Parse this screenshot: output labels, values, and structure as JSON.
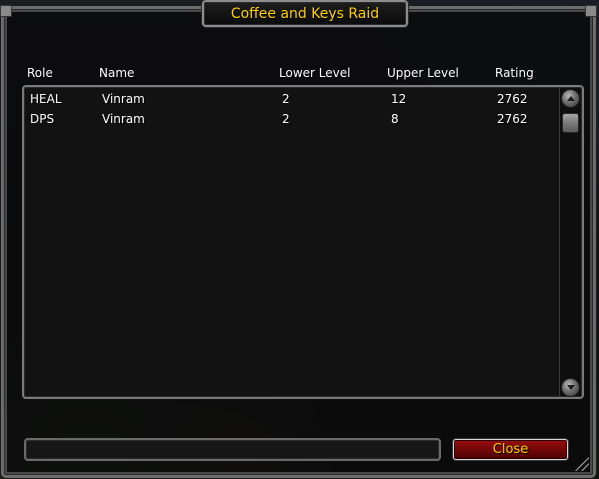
{
  "window": {
    "title": "Coffee and Keys Raid"
  },
  "columns": [
    "Role",
    "Name",
    "Lower Level",
    "Upper Level",
    "Rating"
  ],
  "rows": [
    {
      "role": "HEAL",
      "name": "Vinram",
      "lower": "2",
      "upper": "12",
      "rating": "2762"
    },
    {
      "role": "DPS",
      "name": "Vinram",
      "lower": "2",
      "upper": "8",
      "rating": "2762"
    }
  ],
  "footer": {
    "status_text": "",
    "close_label": "Close"
  },
  "icons": {
    "scroll_up": "scroll-up-icon",
    "scroll_down": "scroll-down-icon",
    "resize": "resize-grip-icon"
  },
  "colors": {
    "title_text": "#ffd100",
    "button_text": "#ffd100",
    "button_bg": "#8b0a0a",
    "list_text": "#ffffff"
  }
}
